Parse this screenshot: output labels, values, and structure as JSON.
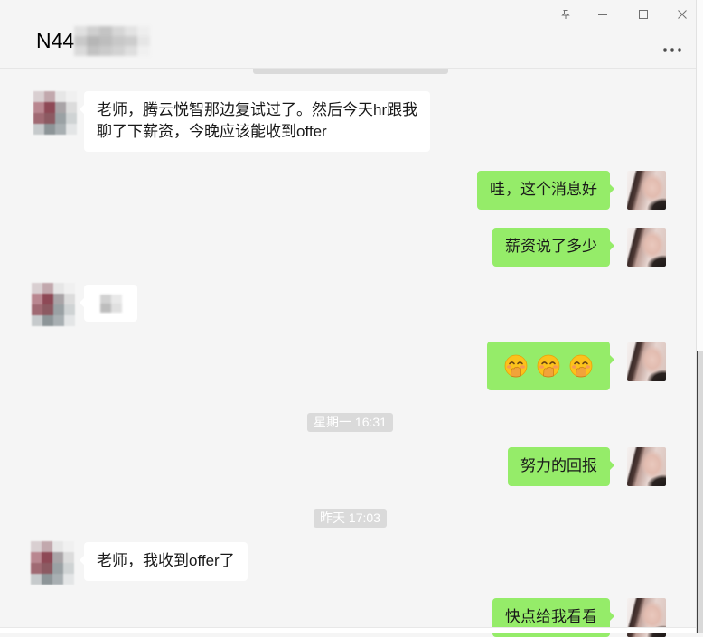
{
  "window": {
    "title": "N44",
    "title_redacted": true,
    "controls": [
      "pin-icon",
      "minimize-icon",
      "maximize-icon",
      "close-icon"
    ],
    "more_icon": "more-icon"
  },
  "colors": {
    "chat_background": "#f5f5f5",
    "outgoing_bubble": "#95ec69",
    "incoming_bubble": "#ffffff",
    "timestamp_pill": "#dadada",
    "timestamp_text": "#ffffff",
    "message_text": "#191919"
  },
  "chat": {
    "messages": [
      {
        "incoming": "老师，腾云悦智那边复试过了。然后今天hr跟我\n聊了下薪资，今晚应该能收到offer"
      },
      {
        "outgoing": "哇，这个消息好"
      },
      {
        "outgoing": "薪资说了多少"
      },
      {
        "incoming_redacted": true
      },
      {
        "outgoing_emoji": [
          "face-with-hand-over-mouth-icon",
          "face-with-hand-over-mouth-icon",
          "face-with-hand-over-mouth-icon"
        ]
      },
      {
        "timestamp": "星期一 16:31"
      },
      {
        "outgoing": "努力的回报"
      },
      {
        "timestamp": "昨天 17:03"
      },
      {
        "incoming": "老师，我收到offer了"
      },
      {
        "outgoing": "快点给我看看"
      }
    ]
  }
}
